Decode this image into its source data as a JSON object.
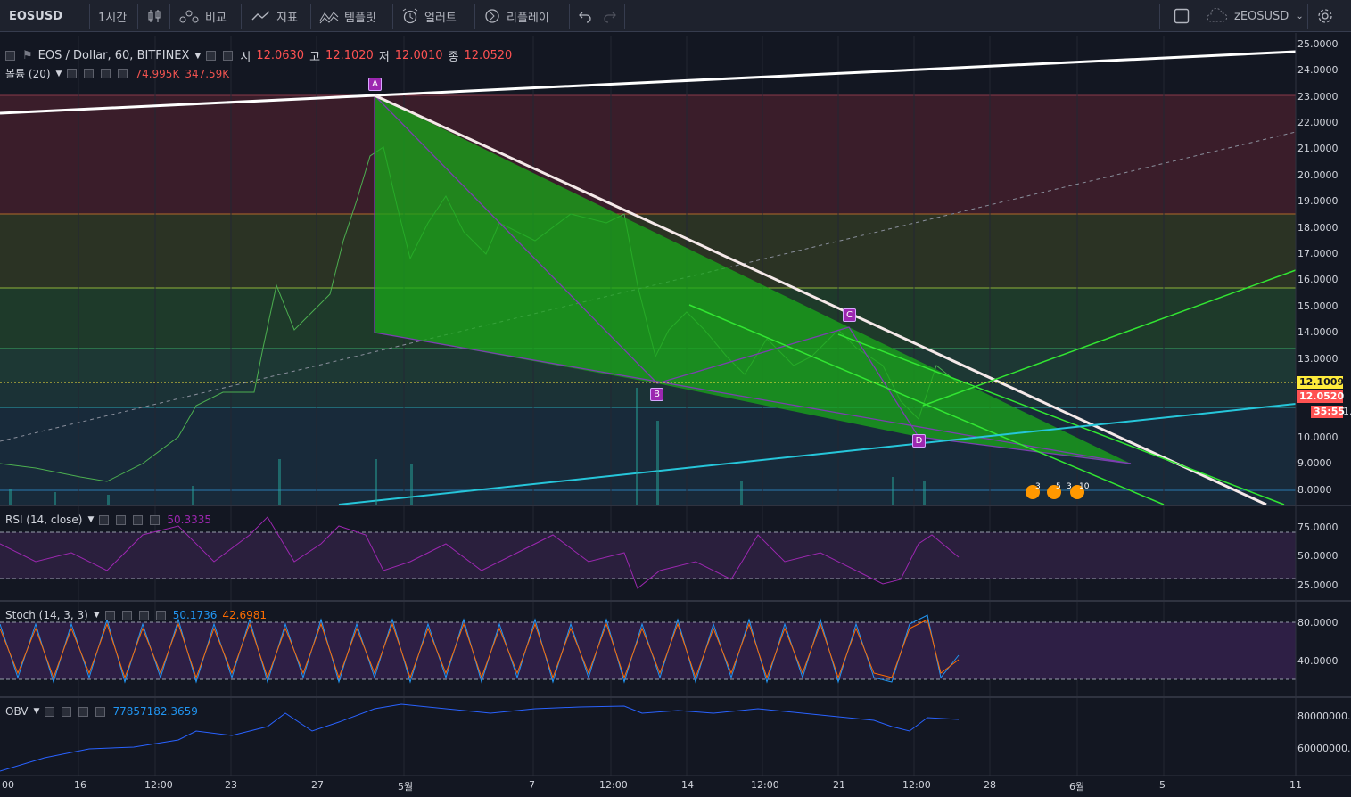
{
  "toolbar": {
    "symbol": "EOSUSD",
    "interval": "1시간",
    "compare": "비교",
    "indicators": "지표",
    "templates": "템플릿",
    "alerts": "얼러트",
    "replay": "리플레이",
    "layout_name": "zEOSUSD"
  },
  "main_legend": {
    "title": "EOS / Dollar, 60, BITFINEX",
    "o_label": "시",
    "o_value": "12.0630",
    "h_label": "고",
    "h_value": "12.1020",
    "l_label": "저",
    "l_value": "12.0010",
    "c_label": "종",
    "c_value": "12.0520"
  },
  "volume_legend": {
    "label": "볼륨 (20)",
    "v1": "74.995K",
    "v2": "347.59K"
  },
  "rsi_legend": {
    "label": "RSI (14, close)",
    "value": "50.3335"
  },
  "stoch_legend": {
    "label": "Stoch (14, 3, 3)",
    "k": "50.1736",
    "d": "42.6981"
  },
  "obv_legend": {
    "label": "OBV",
    "value": "77857182.3659"
  },
  "price_axis": [
    "25.0000",
    "24.0000",
    "23.0000",
    "22.0000",
    "21.0000",
    "20.0000",
    "19.0000",
    "18.0000",
    "17.0000",
    "16.0000",
    "15.0000",
    "14.0000",
    "13.0000",
    "12.0000",
    "11.0000",
    "10.0000",
    "9.0000",
    "8.0000"
  ],
  "price_tags": {
    "yellow": "12.1009",
    "last": "12.0520",
    "timer": "35:55"
  },
  "rsi_axis": [
    "75.0000",
    "50.0000",
    "25.0000"
  ],
  "stoch_axis": [
    "80.0000",
    "40.0000"
  ],
  "obv_axis": [
    "80000000.0",
    "60000000.0"
  ],
  "time_axis": [
    "00",
    "16",
    "12:00",
    "23",
    "27",
    "5월",
    "7",
    "12:00",
    "14",
    "12:00",
    "21",
    "12:00",
    "28",
    "6월",
    "5",
    "11"
  ],
  "pattern_points": [
    "A",
    "B",
    "C",
    "D"
  ],
  "event_badges": [
    "3",
    "5",
    "3",
    "10"
  ],
  "colors": {
    "background": "#131722",
    "pattern_fill": "#1aa81a",
    "up": "#26a69a",
    "down": "#ef5350",
    "rsi": "#9c27b0",
    "stoch_k": "#2196f3",
    "stoch_d": "#ff6d00",
    "last_price": "#ff5252",
    "alert_line": "#ffeb3b"
  }
}
